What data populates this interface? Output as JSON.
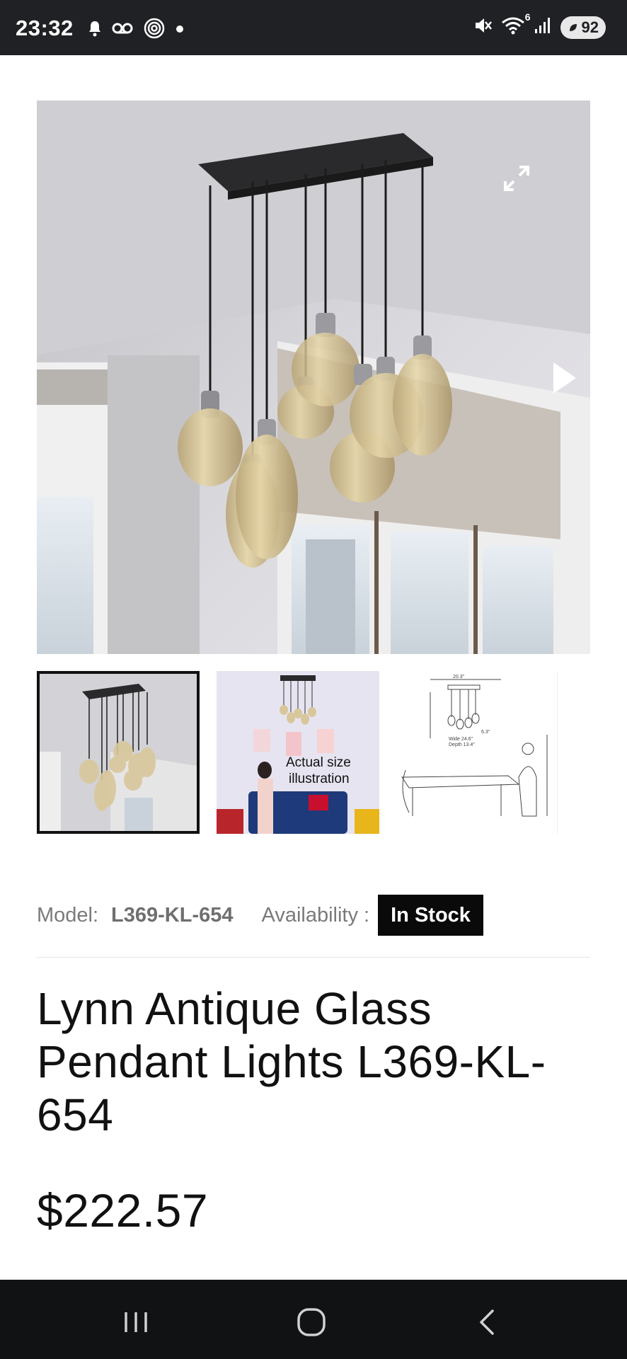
{
  "status_bar": {
    "time": "23:32",
    "icons_left": [
      "bell-icon",
      "voicemail-icon",
      "at-sign-icon",
      "dot-icon"
    ],
    "icons_right": [
      "mute-icon",
      "wifi-icon",
      "signal-icon",
      "battery-icon"
    ],
    "wifi_label": "6",
    "battery_level": "92"
  },
  "gallery": {
    "main_image_alt": "Lynn Antique Glass Pendant Lights chandelier with eight amber glass pendants",
    "expand_icon": "expand-icon",
    "next_icon": "play-next-icon",
    "thumbnails": [
      {
        "name": "thumb-chandelier",
        "selected": true
      },
      {
        "name": "thumb-actual-size",
        "caption_line1": "Actual size",
        "caption_line2": "illustration",
        "selected": false
      },
      {
        "name": "thumb-dimensions",
        "selected": false
      }
    ]
  },
  "product": {
    "model_label": "Model:",
    "model_value": "L369-KL-654",
    "availability_label": "Availability :",
    "availability_value": "In Stock",
    "title": "Lynn Antique Glass Pendant Lights L369-KL-654",
    "price": "$222.57"
  },
  "nav_bar": {
    "buttons": [
      "recent-apps-icon",
      "home-icon",
      "back-icon"
    ]
  },
  "colors": {
    "status_bar_bg": "#202124",
    "nav_bar_bg": "#111214",
    "badge_bg": "#0a0a0a",
    "text": "#111111",
    "meta_text": "#777777"
  }
}
